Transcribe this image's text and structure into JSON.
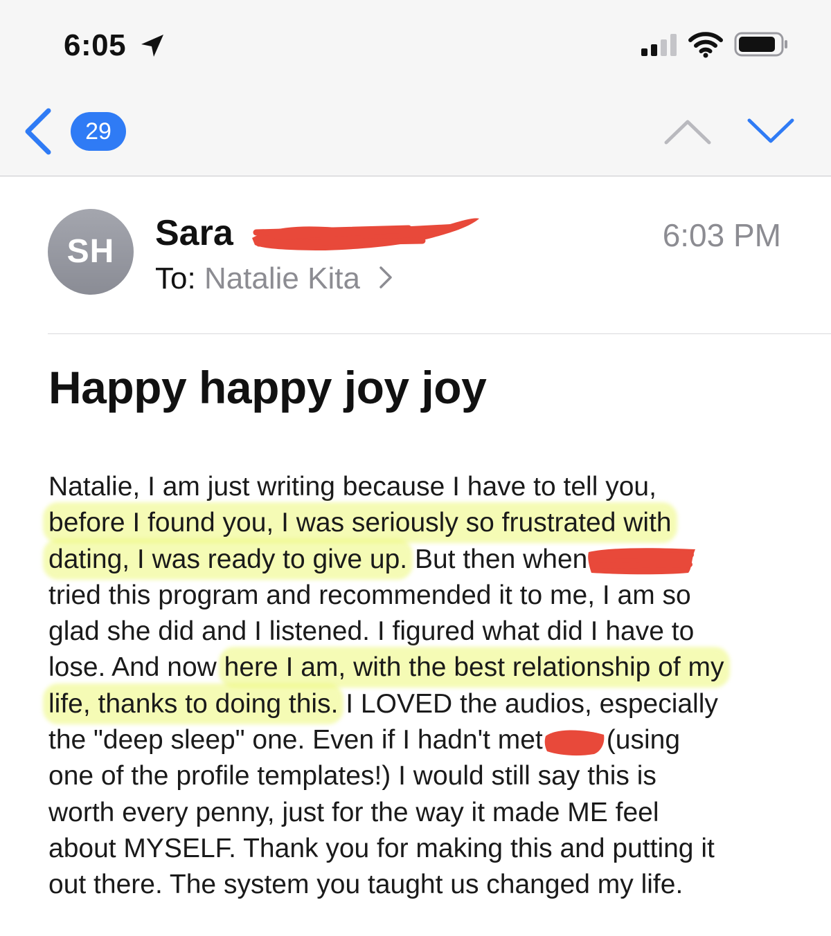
{
  "status_bar": {
    "time": "6:05",
    "icons": [
      "location-arrow-icon",
      "signal-icon",
      "wifi-icon",
      "battery-icon"
    ]
  },
  "nav": {
    "unread_count": "29",
    "icons": [
      "chevron-left-icon",
      "chevron-up-icon",
      "chevron-down-icon"
    ],
    "accent_color": "#2f7bf5"
  },
  "header": {
    "avatar_initials": "SH",
    "sender_visible": "Sara",
    "to_label": "To:",
    "recipient": "Natalie Kita",
    "time": "6:03 PM"
  },
  "subject": "Happy happy joy joy",
  "body": {
    "l1": "Natalie, I am just writing because I have to tell you,",
    "l2": "before I found you, I was seriously so frustrated with",
    "l3a": "dating, I was ready to give up.",
    "l3b": " But then when",
    "l4": "tried this program and recommended it to me, I am so",
    "l5": "glad she did and I listened. I figured what did I have to",
    "l6a": "lose. And now ",
    "l6b": "here I am, with the best relationship of my",
    "l7a": "life, thanks to doing this.",
    "l7b": " I LOVED the audios, especially",
    "l8a": "the \"deep sleep\" one. Even if I hadn't met",
    "l8b": "(using",
    "l9": "one of the profile templates!) I would still say this is",
    "l10": "worth every penny, just for the way it made ME feel",
    "l11": "about MYSELF. Thank you for making this and putting it",
    "l12": "out there. The system you taught us changed my life."
  },
  "colors": {
    "highlight": "#ecf778",
    "redaction": "#e8493a"
  }
}
